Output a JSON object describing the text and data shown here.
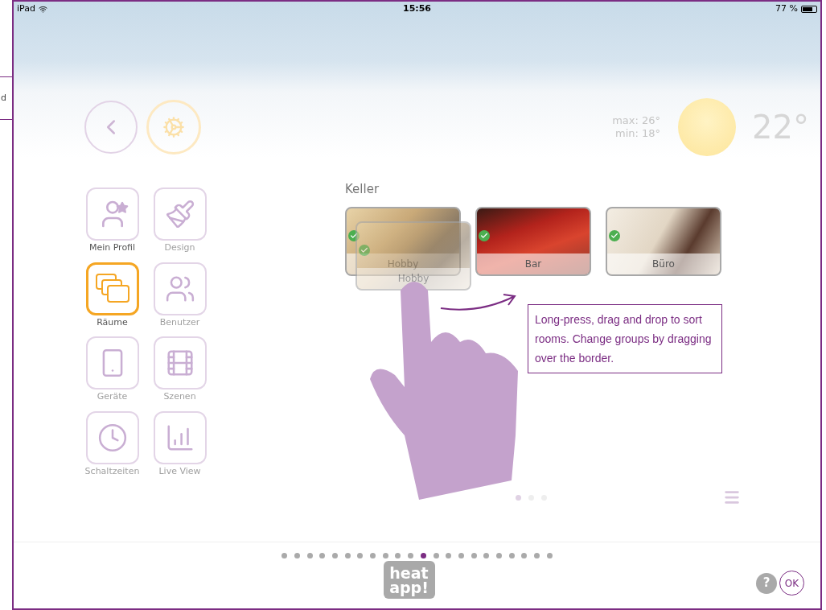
{
  "side_fragment": {
    "text": "d"
  },
  "status_bar": {
    "device": "iPad",
    "time": "15:56",
    "battery": "77 %"
  },
  "weather": {
    "max": "max: 26°",
    "min": "min: 18°",
    "temperature": "22°"
  },
  "menu": [
    {
      "label": "Mein Profil",
      "selected": false,
      "enabled": true
    },
    {
      "label": "Design",
      "selected": false,
      "enabled": false
    },
    {
      "label": "Räume",
      "selected": true,
      "enabled": true
    },
    {
      "label": "Benutzer",
      "selected": false,
      "enabled": false
    },
    {
      "label": "Geräte",
      "selected": false,
      "enabled": false
    },
    {
      "label": "Szenen",
      "selected": false,
      "enabled": false
    },
    {
      "label": "Schaltzeiten",
      "selected": false,
      "enabled": false
    },
    {
      "label": "Live View",
      "selected": false,
      "enabled": false
    }
  ],
  "group": {
    "title": "Keller",
    "rooms": [
      {
        "label": "Hobby",
        "checked": true,
        "dragging": true,
        "ghost_label": "Hobby"
      },
      {
        "label": "Bar",
        "checked": true,
        "dragging": false
      },
      {
        "label": "Büro",
        "checked": true,
        "dragging": false
      }
    ]
  },
  "hint": "Long-press, drag and drop to sort rooms. Change groups by dragging over the border.",
  "room_pages": [
    {
      "selected": true
    },
    {
      "selected": false
    },
    {
      "selected": false
    }
  ],
  "tutorial_pages": [
    {
      "selected": false
    },
    {
      "selected": false
    },
    {
      "selected": false
    },
    {
      "selected": false
    },
    {
      "selected": false
    },
    {
      "selected": false
    },
    {
      "selected": false
    },
    {
      "selected": false
    },
    {
      "selected": false
    },
    {
      "selected": false
    },
    {
      "selected": false
    },
    {
      "selected": true
    },
    {
      "selected": false
    },
    {
      "selected": false
    },
    {
      "selected": false
    },
    {
      "selected": false
    },
    {
      "selected": false
    },
    {
      "selected": false
    },
    {
      "selected": false
    },
    {
      "selected": false
    },
    {
      "selected": false
    },
    {
      "selected": false
    }
  ],
  "logo": {
    "line_1": "heat",
    "line_2": "app!"
  },
  "buttons": {
    "help": "?",
    "ok": "OK"
  }
}
